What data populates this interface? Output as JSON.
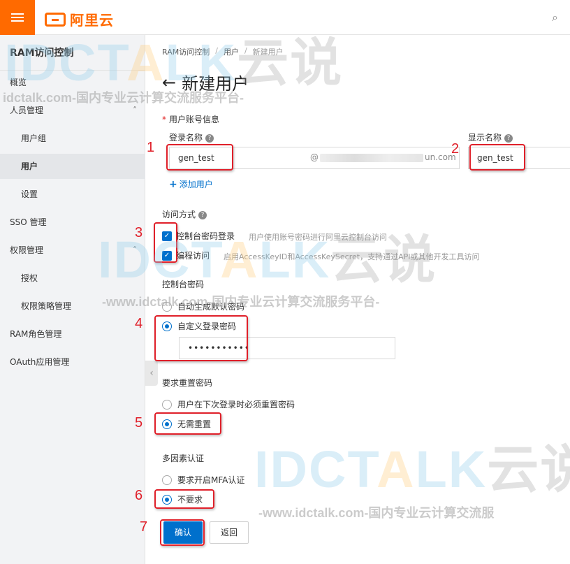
{
  "header": {
    "brand_name": "阿里云",
    "menu_icon": "hamburger-icon",
    "search_icon": "search-icon",
    "brand_color": "#ff6a00"
  },
  "sidebar": {
    "title": "RAM访问控制",
    "items": [
      {
        "label": "概览"
      },
      {
        "label": "人员管理"
      },
      {
        "label": "用户组"
      },
      {
        "label": "用户"
      },
      {
        "label": "设置"
      },
      {
        "label": "SSO 管理"
      },
      {
        "label": "权限管理"
      },
      {
        "label": "授权"
      },
      {
        "label": "权限策略管理"
      },
      {
        "label": "RAM角色管理"
      },
      {
        "label": "OAuth应用管理"
      }
    ]
  },
  "breadcrumb": [
    "RAM访问控制",
    "用户",
    "新建用户"
  ],
  "breadcrumb_separator": "/",
  "page_title": "新建用户",
  "form": {
    "account_info_label": "用户账号信息",
    "login_name_label": "登录名称",
    "login_name_value": "gen_test",
    "domain_prefix": "@",
    "domain_suffix": "un.com",
    "display_name_label": "显示名称",
    "display_name_value": "gen_test",
    "add_user_label": "添加用户",
    "access_label": "访问方式",
    "access_options": [
      {
        "label": "控制台密码登录",
        "desc": "用户使用账号密码进行阿里云控制台访问",
        "checked": true
      },
      {
        "label": "编程访问",
        "desc": "启用AccessKeyID和AccessKeySecret，支持通过API或其他开发工具访问",
        "checked": true
      }
    ],
    "console_password_label": "控制台密码",
    "password_options": [
      {
        "label": "自动生成默认密码",
        "selected": false
      },
      {
        "label": "自定义登录密码",
        "selected": true
      }
    ],
    "password_value": "•••••••••••",
    "reset_label": "要求重置密码",
    "reset_options": [
      {
        "label": "用户在下次登录时必须重置密码",
        "selected": false
      },
      {
        "label": "无需重置",
        "selected": true
      }
    ],
    "mfa_label": "多因素认证",
    "mfa_options": [
      {
        "label": "要求开启MFA认证",
        "selected": false
      },
      {
        "label": "不要求",
        "selected": true
      }
    ],
    "confirm_label": "确认",
    "back_label": "返回",
    "accent_color": "#0070cc"
  },
  "annotations": [
    "1",
    "2",
    "3",
    "4",
    "5",
    "6",
    "7"
  ],
  "annotation_color": "#e0202a",
  "watermark": {
    "logo_left": "IDC",
    "logo_mid": "T",
    "logo_accent": "A",
    "logo_right": "LK",
    "logo_cn": "云说",
    "line_top": "idctalk.com-国内专业云计算交流服务平台-",
    "line_mid": "-www.idctalk.com-国内专业云计算交流服务平台-",
    "line_bottom": "-www.idctalk.com-国内专业云计算交流服"
  }
}
